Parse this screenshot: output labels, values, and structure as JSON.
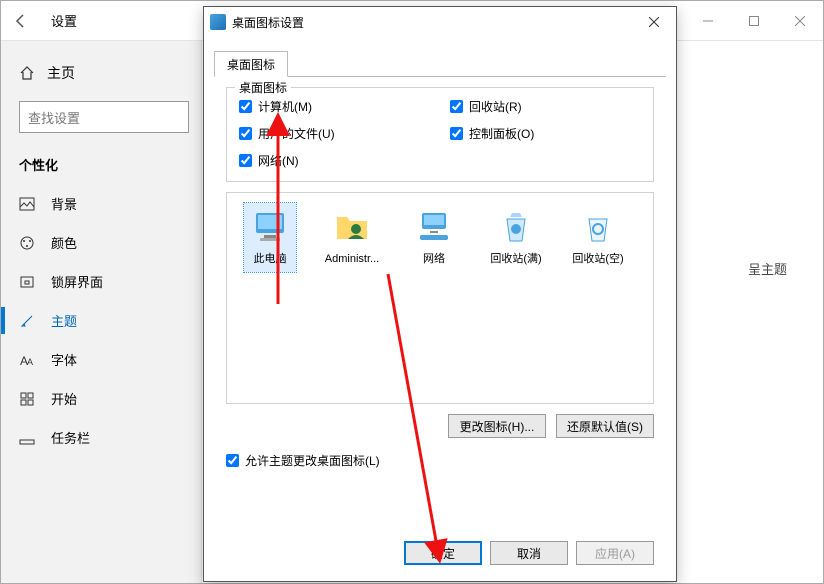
{
  "settings": {
    "title": "设置",
    "home": "主页",
    "search_placeholder": "查找设置",
    "section": "个性化",
    "nav": {
      "background": "背景",
      "colors": "颜色",
      "lockscreen": "锁屏界面",
      "themes": "主题",
      "fonts": "字体",
      "start": "开始",
      "taskbar": "任务栏"
    },
    "related_partial": "呈主题"
  },
  "dialog": {
    "title": "桌面图标设置",
    "tab": "桌面图标",
    "group_title": "桌面图标",
    "checks": {
      "computer": "计算机(M)",
      "recycle": "回收站(R)",
      "userfiles": "用户的文件(U)",
      "control": "控制面板(O)",
      "network": "网络(N)"
    },
    "icons": {
      "thispc": "此电脑",
      "admin": "Administr...",
      "network": "网络",
      "recycle_full": "回收站(满)",
      "recycle_empty": "回收站(空)"
    },
    "change_icon": "更改图标(H)...",
    "restore_default": "还原默认值(S)",
    "allow_theme": "允许主题更改桌面图标(L)",
    "ok": "确定",
    "cancel": "取消",
    "apply": "应用(A)"
  }
}
